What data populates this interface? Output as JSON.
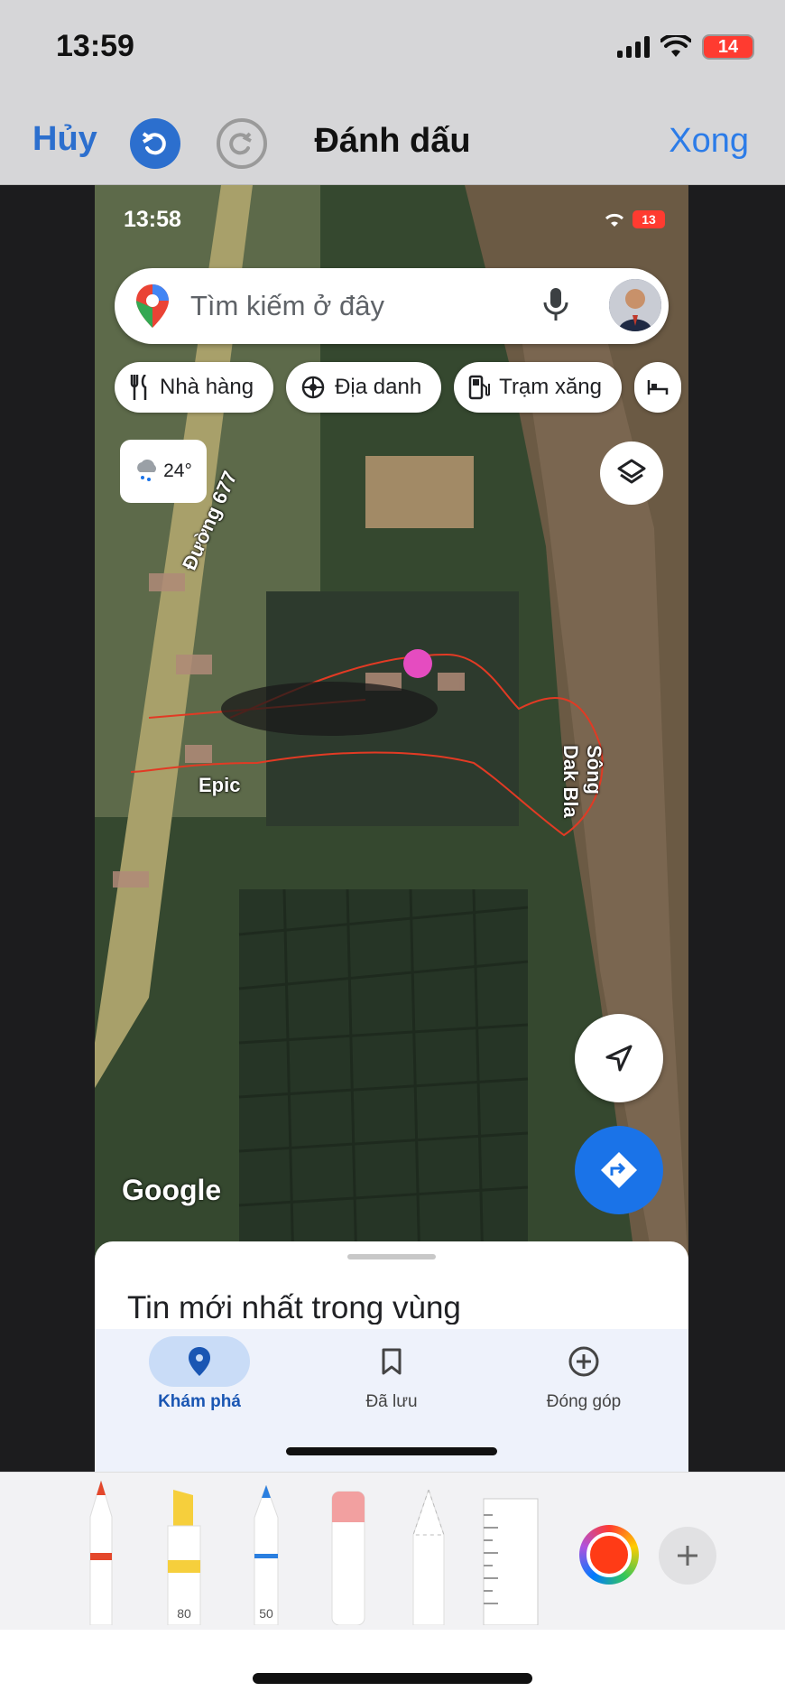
{
  "outer_status": {
    "time": "13:59",
    "battery": "14"
  },
  "markup_bar": {
    "cancel": "Hủy",
    "title": "Đánh dấu",
    "done": "Xong",
    "undo_icon": "undo-icon",
    "redo_icon": "redo-icon"
  },
  "screenshot": {
    "status": {
      "time": "13:58",
      "battery": "13"
    },
    "search": {
      "placeholder": "Tìm kiếm ở đây"
    },
    "chips": [
      {
        "label": "Nhà hàng",
        "icon": "fork-knife-icon"
      },
      {
        "label": "Địa danh",
        "icon": "landmark-icon"
      },
      {
        "label": "Trạm xăng",
        "icon": "gas-station-icon"
      }
    ],
    "weather": {
      "temp": "24°"
    },
    "map_labels": {
      "road": "Đường 677",
      "river": "Sông Dak Bla",
      "place": "Epic"
    },
    "brand": "Google",
    "sheet": {
      "title": "Tin mới nhất trong vùng"
    },
    "nav": [
      {
        "label": "Khám phá",
        "icon": "location-pin-icon",
        "active": true
      },
      {
        "label": "Đã lưu",
        "icon": "bookmark-icon",
        "active": false
      },
      {
        "label": "Đóng góp",
        "icon": "add-circle-icon",
        "active": false
      }
    ]
  },
  "palette": {
    "tools": [
      {
        "name": "pen",
        "tip_color": "#e4472b"
      },
      {
        "name": "highlighter",
        "tip_color": "#f6cf3c",
        "size": "80"
      },
      {
        "name": "pencil",
        "tip_color": "#2a7fe0",
        "size": "50"
      },
      {
        "name": "eraser",
        "tip_color": "#f2a0a0"
      },
      {
        "name": "lasso",
        "tip_color": "#cccccc"
      },
      {
        "name": "ruler",
        "tip_color": "#ffffff"
      }
    ],
    "current_color": "#ff3b16"
  }
}
